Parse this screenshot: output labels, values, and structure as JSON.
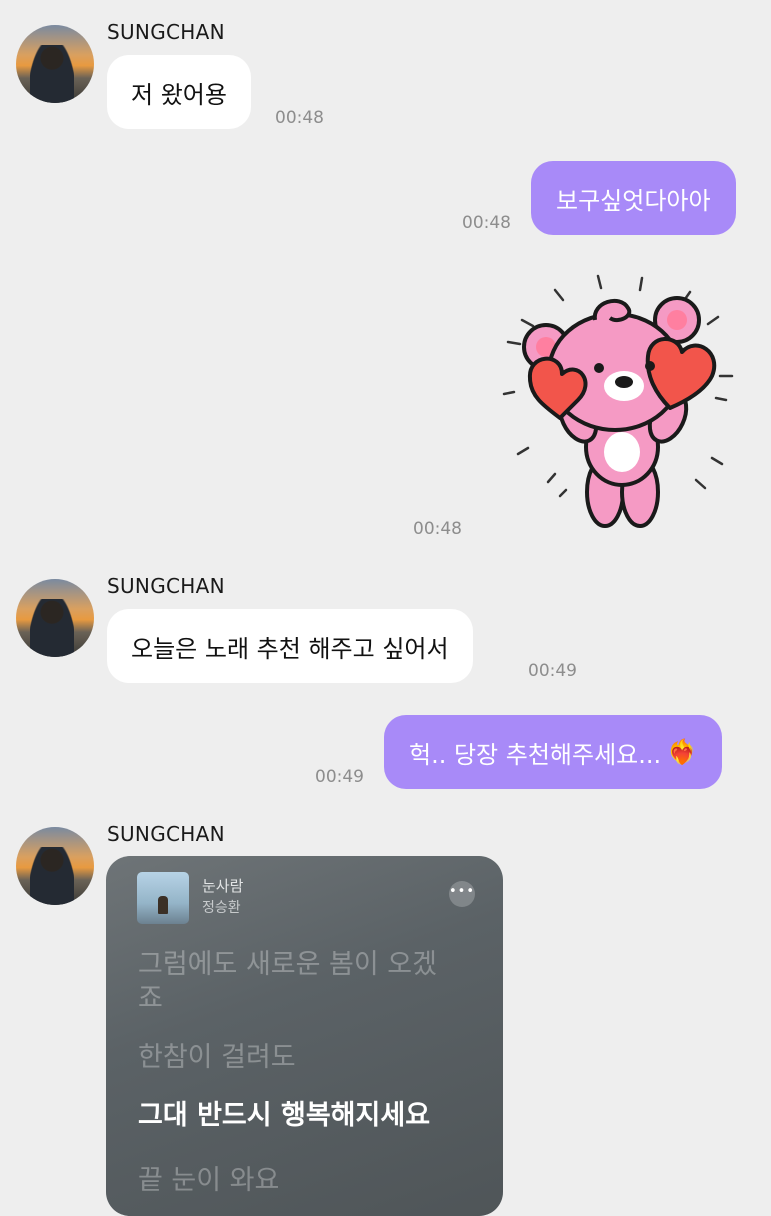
{
  "messages": {
    "m1": {
      "sender": "SUNGCHAN",
      "text": "저 왔어용",
      "time": "00:48"
    },
    "m2": {
      "text": "보구싶엇다아아",
      "time": "00:48"
    },
    "m3": {
      "sticker": "pink-bear-holding-hearts",
      "time": "00:48"
    },
    "m4": {
      "sender": "SUNGCHAN",
      "text": "오늘은 노래 추천 해주고 싶어서",
      "time": "00:49"
    },
    "m5": {
      "text": "헉.. 당장 추천해주세요...",
      "emoji": "❤️‍🔥",
      "time": "00:49"
    },
    "m6": {
      "sender": "SUNGCHAN",
      "song_title": "눈사람",
      "song_artist": "정승환",
      "more": "•••",
      "lyrics": {
        "line1a": "그럼에도 새로운 봄이 오겠",
        "line1b": "죠",
        "line2": "한참이 걸려도",
        "line3": "그대 반드시 행복해지세요",
        "line4": "끝 눈이 와요"
      }
    }
  },
  "colors": {
    "outgoing_bubble": "#a88af8",
    "incoming_bubble": "#ffffff",
    "background": "#eeeeee"
  }
}
